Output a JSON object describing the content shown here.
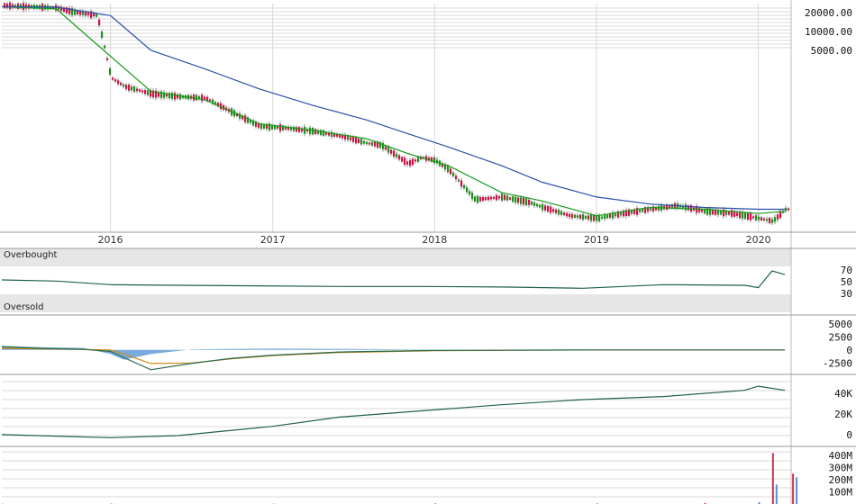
{
  "colors": {
    "up": "#1a8f1a",
    "down": "#cc1144",
    "sma_short": "#1c9b1c",
    "sma_long": "#2a4fa8",
    "rsi": "#1f5f4a",
    "macd_line": "#2a6a4a",
    "signal_line": "#d08a18",
    "histogram": "#4a8fd0",
    "obv": "#1f5f4a",
    "volume": "#5a8fd0",
    "volume_down": "#cc3355",
    "grid": "#d8d8d8",
    "band": "#e6e6e6"
  },
  "chart_data": [
    {
      "type": "line",
      "panel": "price",
      "x_ticks": [
        "2016",
        "2017",
        "2018",
        "2019",
        "2020"
      ],
      "y_ticks": [
        "20000.00",
        "10000.00",
        "5000.00"
      ],
      "y_scale": "log",
      "ylim": [
        6,
        28000
      ],
      "grid": true,
      "series": [
        {
          "style": "candlestick",
          "x": [
            "2015-05",
            "2015-07",
            "2015-09",
            "2015-10",
            "2015-12",
            "2016-01",
            "2016-02",
            "2016-04",
            "2016-06",
            "2016-08",
            "2016-10",
            "2016-12",
            "2017-02",
            "2017-04",
            "2017-06",
            "2017-08",
            "2017-09",
            "2017-11",
            "2017-12",
            "2018-01",
            "2018-02",
            "2018-04",
            "2018-06",
            "2018-08",
            "2018-09",
            "2018-11",
            "2019-01",
            "2019-03",
            "2019-05",
            "2019-07",
            "2019-09",
            "2019-11",
            "2020-01",
            "2020-02",
            "2020-03"
          ],
          "values": [
            26000,
            25000,
            24000,
            21000,
            18000,
            1800,
            1300,
            1000,
            900,
            850,
            500,
            300,
            280,
            250,
            210,
            160,
            150,
            75,
            95,
            85,
            60,
            20,
            22,
            18,
            15,
            11,
            10,
            12,
            14,
            16,
            13,
            12,
            10,
            9,
            14
          ]
        },
        {
          "name": "",
          "x": [
            "2015-05",
            "2015-09",
            "2016-01",
            "2016-04",
            "2016-08",
            "2016-12",
            "2017-04",
            "2017-08",
            "2017-11",
            "2018-02",
            "2018-06",
            "2018-09",
            "2019-01",
            "2019-05",
            "2019-09",
            "2020-01",
            "2020-03"
          ],
          "values": [
            25000,
            23000,
            4000,
            1100,
            800,
            330,
            260,
            190,
            110,
            70,
            26,
            19,
            11,
            15,
            14,
            12,
            13
          ]
        },
        {
          "name": "",
          "x": [
            "2015-05",
            "2015-09",
            "2016-01",
            "2016-04",
            "2016-08",
            "2016-12",
            "2017-04",
            "2017-08",
            "2017-11",
            "2018-02",
            "2018-06",
            "2018-09",
            "2019-01",
            "2019-05",
            "2019-09",
            "2020-01",
            "2020-03"
          ],
          "values": [
            25000,
            24500,
            18000,
            5000,
            2500,
            1200,
            650,
            380,
            230,
            140,
            70,
            38,
            22,
            17,
            15,
            14,
            14
          ]
        }
      ]
    },
    {
      "type": "line",
      "panel": "rsi",
      "band_labels": [
        "Overbought",
        "Oversold"
      ],
      "y_ticks": [
        "70",
        "50",
        "30"
      ],
      "ylim": [
        0,
        100
      ],
      "x": [
        "2015-05",
        "2015-09",
        "2016-01",
        "2016-06",
        "2016-12",
        "2017-06",
        "2017-12",
        "2018-06",
        "2018-12",
        "2019-06",
        "2019-12",
        "2020-01",
        "2020-02",
        "2020-03"
      ],
      "values": [
        53,
        51,
        45,
        44,
        43,
        42,
        42,
        41,
        39,
        45,
        44,
        40,
        68,
        62
      ]
    },
    {
      "type": "line",
      "panel": "macd",
      "y_ticks": [
        "5000",
        "2500",
        "0",
        "-2500"
      ],
      "ylim": [
        -4000,
        6000
      ],
      "x": [
        "2015-05",
        "2015-08",
        "2015-11",
        "2016-01",
        "2016-02",
        "2016-04",
        "2016-07",
        "2016-10",
        "2017-01",
        "2017-06",
        "2018-01",
        "2019-01",
        "2020-03"
      ],
      "series": [
        {
          "name": "",
          "values": [
            600,
            300,
            100,
            -300,
            -1500,
            -3800,
            -2600,
            -1600,
            -1000,
            -400,
            -100,
            0,
            0
          ]
        },
        {
          "name": "",
          "values": [
            300,
            200,
            80,
            0,
            -800,
            -2600,
            -2500,
            -1700,
            -1100,
            -500,
            -150,
            0,
            0
          ]
        },
        {
          "name": "",
          "style": "histogram",
          "values": [
            800,
            500,
            400,
            -800,
            -1900,
            -800,
            100,
            200,
            250,
            200,
            50,
            0,
            0
          ]
        }
      ]
    },
    {
      "type": "line",
      "panel": "obv",
      "y_ticks": [
        "40K",
        "20K",
        "0"
      ],
      "ylim": [
        -8000,
        55000
      ],
      "x": [
        "2015-05",
        "2015-09",
        "2016-01",
        "2016-06",
        "2017-01",
        "2017-06",
        "2018-01",
        "2018-06",
        "2018-12",
        "2019-06",
        "2019-12",
        "2020-01",
        "2020-03"
      ],
      "values": [
        0,
        -1500,
        -3000,
        -1000,
        8000,
        17000,
        24000,
        29000,
        34000,
        37000,
        43000,
        47000,
        43000
      ]
    },
    {
      "type": "bar",
      "panel": "volume",
      "y_ticks": [
        "400M",
        "300M",
        "200M",
        "100M"
      ],
      "ylim": [
        0,
        460000000
      ],
      "x": [
        "2015-05",
        "2016-01",
        "2017-01",
        "2018-01",
        "2019-01",
        "2019-09",
        "2020-01",
        "2020-02",
        "2020-02",
        "2020-03",
        "2020-03"
      ],
      "values": [
        2000000,
        3000000,
        3000000,
        4000000,
        5000000,
        8000000,
        15000000,
        420000000,
        160000000,
        250000000,
        220000000
      ]
    }
  ]
}
